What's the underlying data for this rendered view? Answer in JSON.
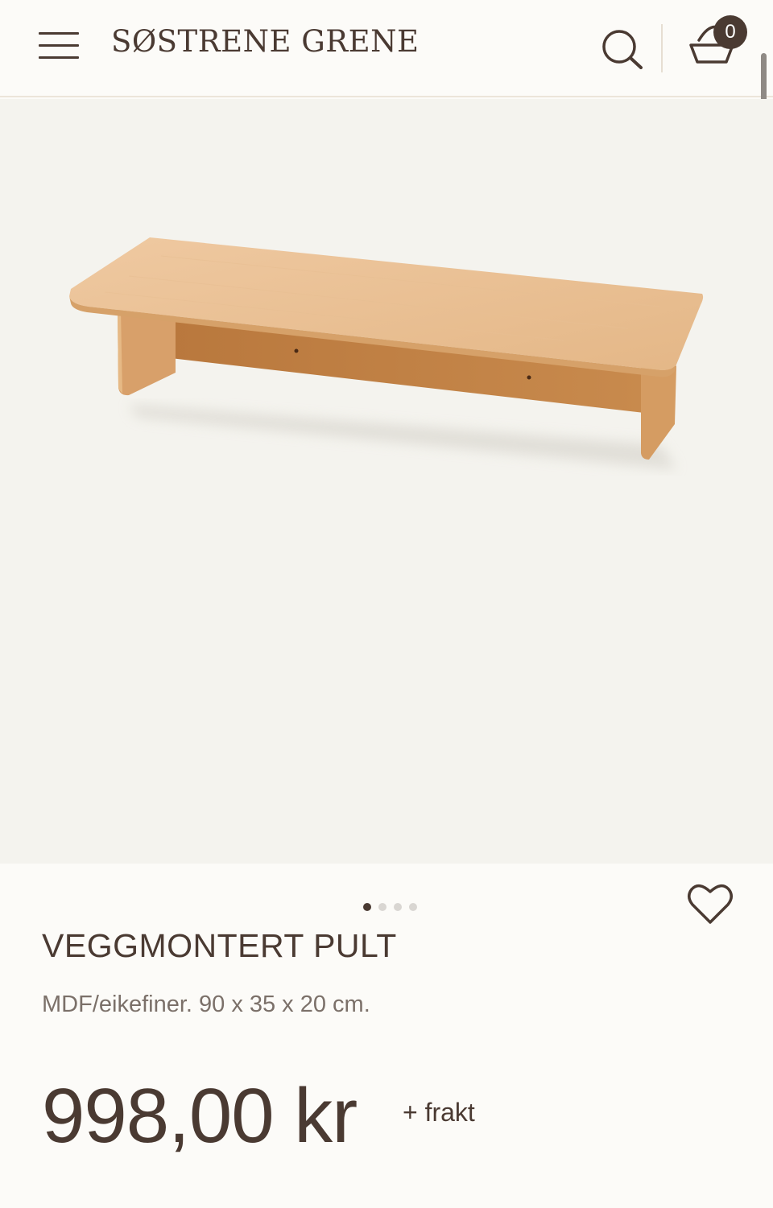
{
  "header": {
    "brand": "SØSTRENE GRENE",
    "cart_count": "0"
  },
  "carousel": {
    "total_images": 4,
    "active_index": 0
  },
  "product": {
    "title": "VEGGMONTERT PULT",
    "description": "MDF/eikefiner. 90 x 35 x 20 cm.",
    "price": "998,00 kr",
    "shipping_note": "+ frakt"
  },
  "colors": {
    "brand_text": "#4a3a32",
    "background": "#fcfbf8",
    "image_background": "#f4f3ee"
  }
}
